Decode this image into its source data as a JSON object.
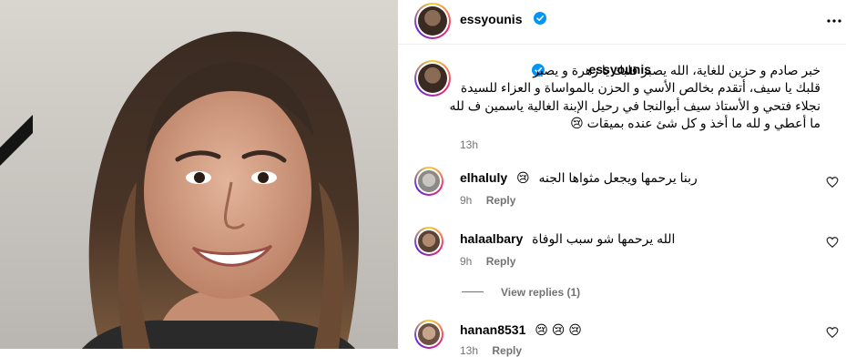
{
  "post": {
    "author": "essyounis",
    "verified": true,
    "more_icon": "more-horizontal-icon",
    "caption_lines": [
      "خبر صادم و حزين للغاية، الله يصبر قلبك يا زهرة و يصبر",
      "قلبك يا سيف، أتقدم بخالص الأسي و الحزن بالمواساة و العزاء للسيدة",
      "نجلاء فتحي و الأستاذ سيف أبوالنجا في رحيل الإبنة الغالية ياسمين ف لله",
      "ما أعطي و لله ما أخذ و كل شئ عنده بميقات"
    ],
    "caption_emoji": "😢",
    "time": "13h"
  },
  "comments": [
    {
      "username": "elhaluly",
      "text": "ربنا يرحمها ويجعل مثواها الجنه",
      "emoji": "😢",
      "time": "9h",
      "reply": "Reply"
    },
    {
      "username": "halaalbary",
      "text": "الله يرحمها شو سبب الوفاة",
      "emoji": "",
      "time": "9h",
      "reply": "Reply",
      "view_replies": "View replies (1)"
    },
    {
      "username": "hanan8531",
      "text": "",
      "emoji": "😢 😢 😢",
      "time": "13h",
      "reply": "Reply"
    }
  ],
  "colors": {
    "verified": "#0095f6",
    "meta": "#737373",
    "divider": "#efefef"
  }
}
